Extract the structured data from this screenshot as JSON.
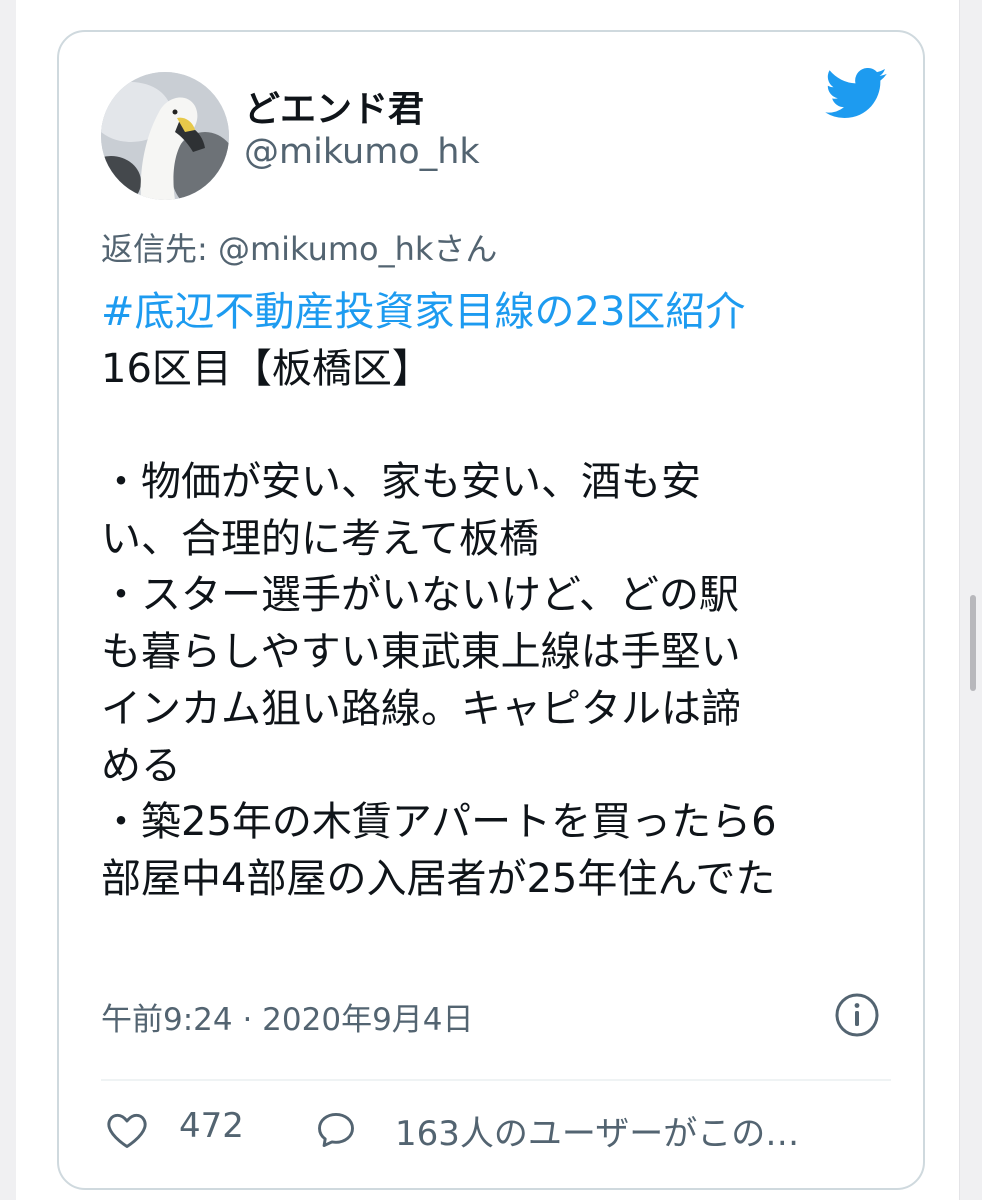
{
  "tweet": {
    "display_name": "どエンド君",
    "handle": "@mikumo_hk",
    "reply_to": "返信先: @mikumo_hkさん",
    "hashtag": "#底辺不動産投資家目線の23区紹介",
    "lines": [
      "16区目【板橋区】",
      "",
      "・物価が安い、家も安い、酒も安",
      "い、合理的に考えて板橋",
      "・スター選手がいないけど、どの駅",
      "も暮らしやすい東武東上線は手堅い",
      "インカム狙い路線。キャピタルは諦",
      "める",
      "・築25年の木賃アパートを買ったら6",
      "部屋中4部屋の入居者が25年住んでた"
    ],
    "timestamp": "午前9:24 · 2020年9月4日",
    "likes": "472",
    "replies_text": "163人のユーザーがこの…"
  },
  "icons": {
    "brand": "twitter-bird-icon",
    "info": "info-icon",
    "like": "heart-icon",
    "reply": "speech-bubble-icon",
    "avatar": "swan-avatar"
  },
  "colors": {
    "brand_blue": "#1d9bf0",
    "text_primary": "#0f1419",
    "text_secondary": "#536471",
    "card_border": "#cfd9de"
  }
}
